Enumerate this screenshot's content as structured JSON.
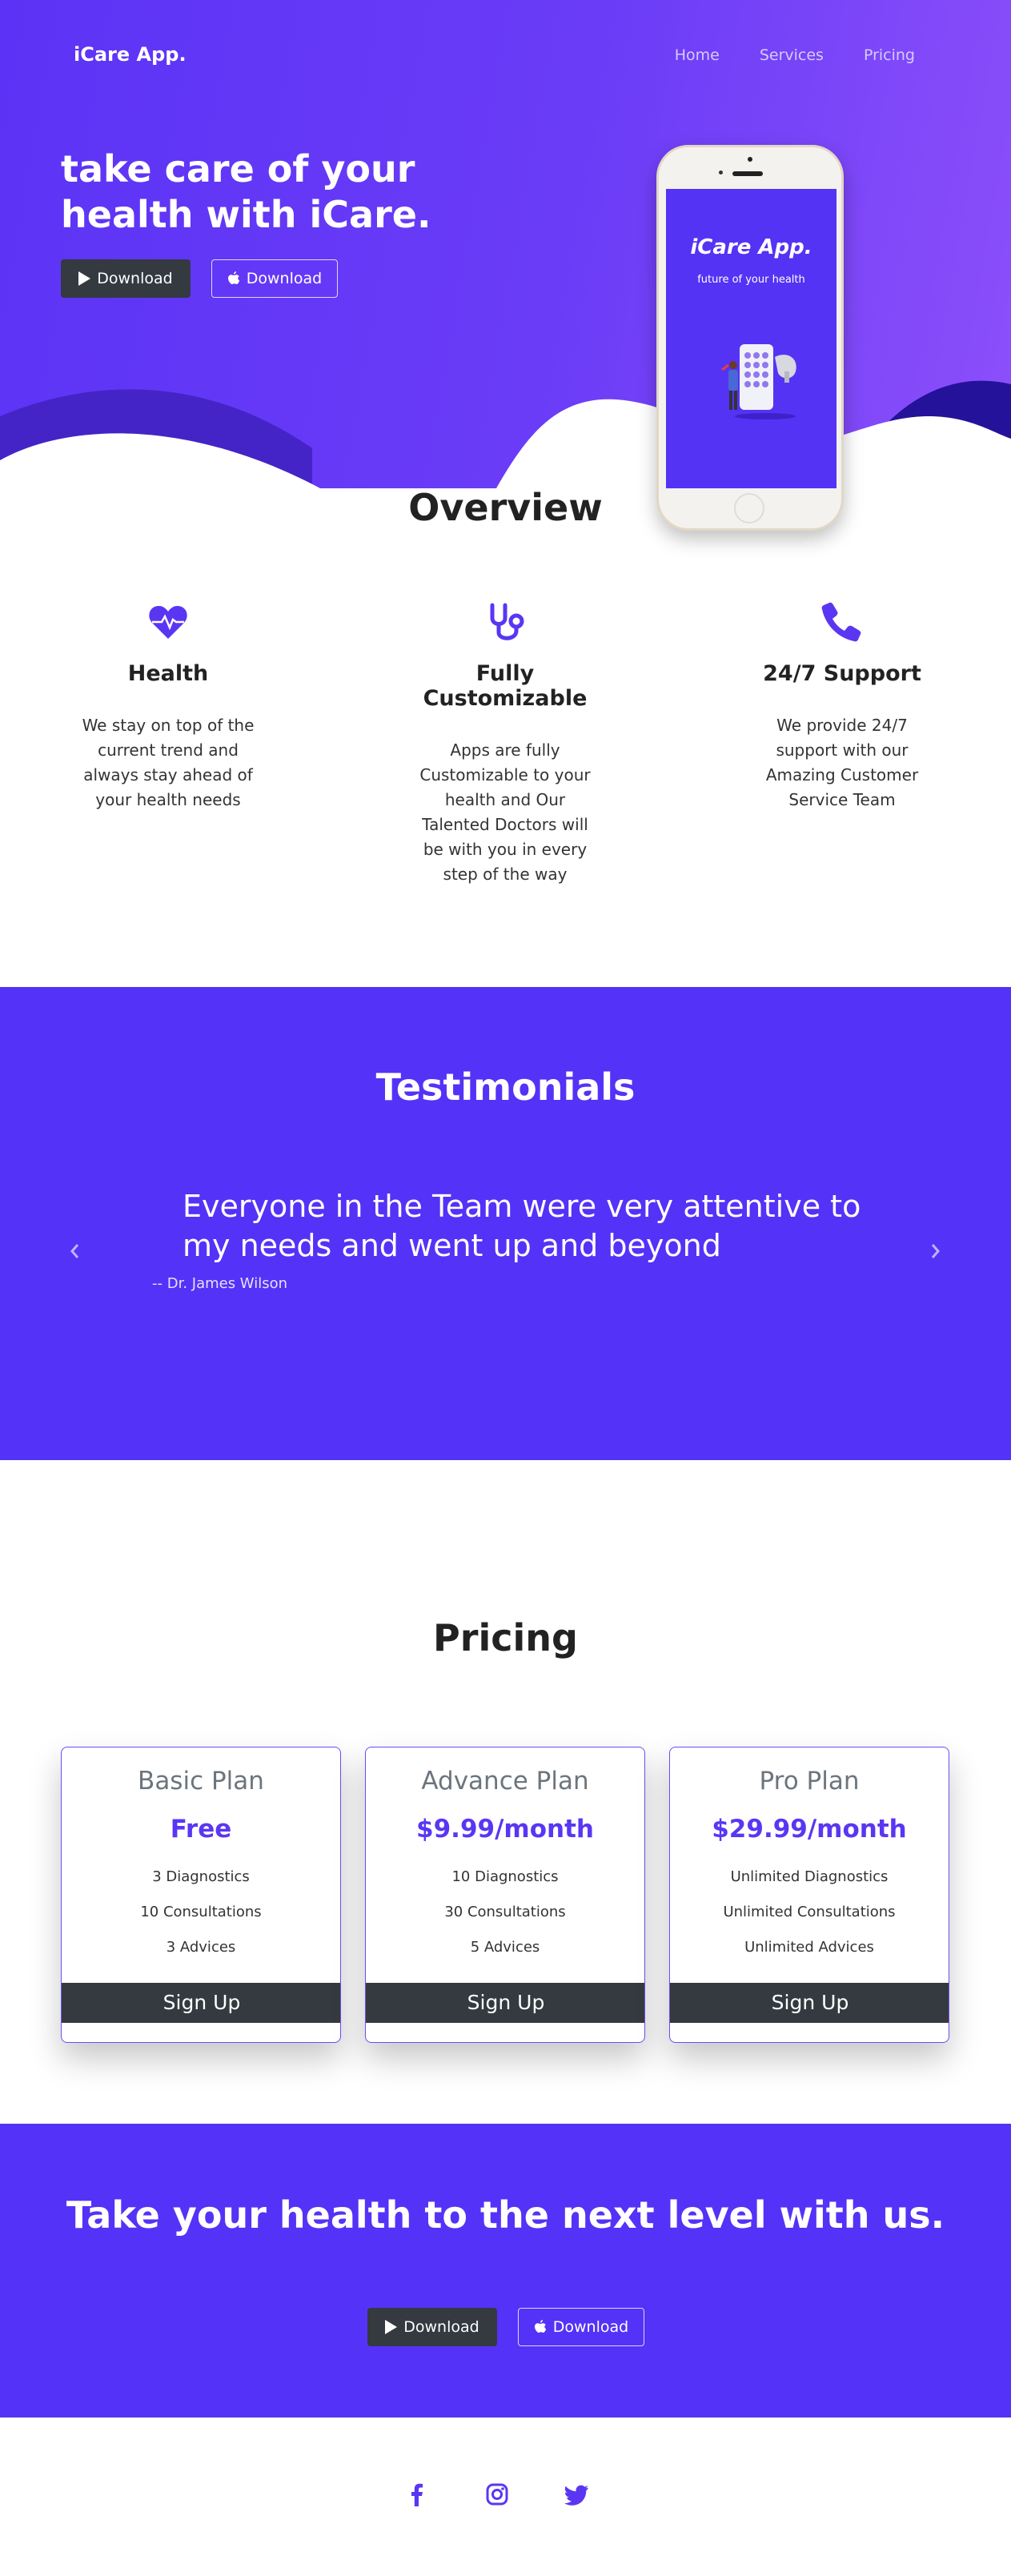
{
  "brand": "iCare App.",
  "nav": [
    "Home",
    "Services",
    "Pricing"
  ],
  "hero": {
    "title": "take care of your health with iCare.",
    "download_android": "Download",
    "download_ios": "Download"
  },
  "phone_screen": {
    "title": "iCare App.",
    "subtitle": "future of your health"
  },
  "overview": {
    "title": "Overview",
    "features": [
      {
        "title": "Health",
        "text": "We stay on top of the current trend and always stay ahead of your health needs",
        "icon": "heartbeat-icon"
      },
      {
        "title": "Fully Customizable",
        "text": "Apps are fully Customizable to your health and Our Talented Doctors will be with you in every step of the way",
        "icon": "stethoscope-icon"
      },
      {
        "title": "24/7 Support",
        "text": "We provide 24/7 support with our Amazing Customer Service Team",
        "icon": "phone-icon"
      }
    ]
  },
  "testimonials": {
    "title": "Testimonials",
    "quote": "Everyone in the Team were very attentive to my needs and went up and beyond",
    "author": "-- Dr. James Wilson"
  },
  "pricing": {
    "title": "Pricing",
    "plans": [
      {
        "name": "Basic Plan",
        "price": "Free",
        "features": [
          "3 Diagnostics",
          "10 Consultations",
          "3 Advices"
        ],
        "cta": "Sign Up"
      },
      {
        "name": "Advance Plan",
        "price": "$9.99/month",
        "features": [
          "10 Diagnostics",
          "30 Consultations",
          "5 Advices"
        ],
        "cta": "Sign Up"
      },
      {
        "name": "Pro Plan",
        "price": "$29.99/month",
        "features": [
          "Unlimited Diagnostics",
          "Unlimited Consultations",
          "Unlimited Advices"
        ],
        "cta": "Sign Up"
      }
    ]
  },
  "cta": {
    "title": "Take your health to the next level with us.",
    "download_android": "Download",
    "download_ios": "Download"
  },
  "footer": {
    "social": [
      "facebook-icon",
      "instagram-icon",
      "twitter-icon"
    ]
  },
  "colors": {
    "primary": "#5532f7",
    "gradient_end": "#8c4ffa",
    "dark_button": "#343a40",
    "wave_dark": "#2e1a9e"
  }
}
